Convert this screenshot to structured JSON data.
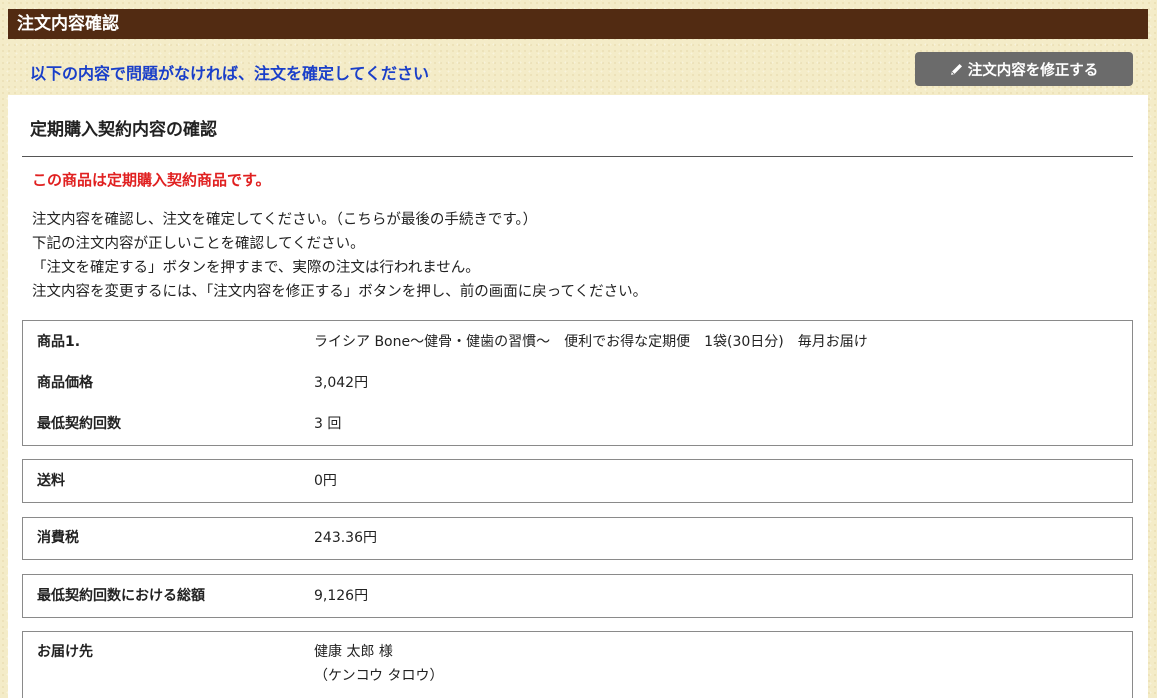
{
  "header": {
    "title": "注文内容確認"
  },
  "top": {
    "instruction": "以下の内容で問題がなければ、注文を確定してください",
    "edit_button": "注文内容を修正する",
    "edit_icon": "pencil-icon"
  },
  "contract": {
    "title": "定期購入契約内容の確認",
    "notice": "この商品は定期購入契約商品です。",
    "description": [
      "注文内容を確認し、注文を確定してください。（こちらが最後の手続きです。）",
      "下記の注文内容が正しいことを確認してください。",
      "「注文を確定する」ボタンを押すまで、実際の注文は行われません。",
      "注文内容を変更するには、「注文内容を修正する」ボタンを押し、前の画面に戻ってください。"
    ]
  },
  "product": {
    "label": "商品1.",
    "name": "ライシア Bone〜健骨・健歯の習慣〜　便利でお得な定期便　1袋(30日分)　毎月お届け",
    "price_label": "商品価格",
    "price": "3,042円",
    "min_count_label": "最低契約回数",
    "min_count": "3 回"
  },
  "shipping": {
    "label": "送料",
    "value": "0円"
  },
  "tax": {
    "label": "消費税",
    "value": "243.36円"
  },
  "total": {
    "label": "最低契約回数における総額",
    "value": "9,126円"
  },
  "delivery": {
    "label": "お届け先",
    "name": "健康 太郎 様",
    "kana": "（ケンコウ タロウ）"
  },
  "colors": {
    "header_bg": "#522b12",
    "instruction": "#1a3fc9",
    "notice": "#e02020",
    "button_bg": "#6b6b6b",
    "page_bg": "#f4ecc8"
  }
}
